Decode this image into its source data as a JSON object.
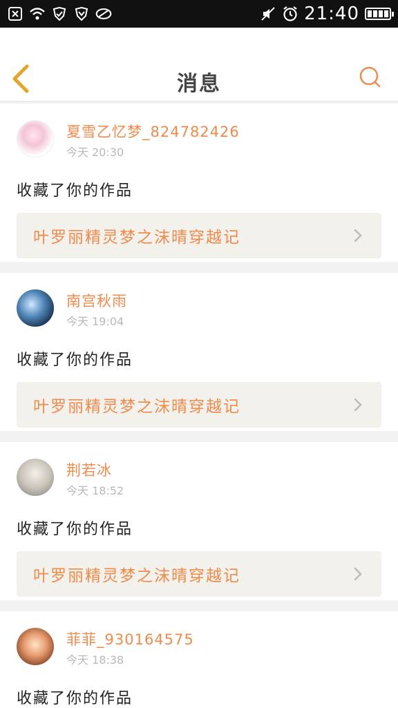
{
  "status_bar": {
    "time": "21:40"
  },
  "nav": {
    "title": "消息"
  },
  "colors": {
    "accent": "#f08a4b",
    "back_chevron": "#e5a52a",
    "link_bg": "#f2f1ec",
    "timestamp": "#b8b8b8"
  },
  "messages": [
    {
      "username": "夏雪乙忆梦_824782426",
      "time": "今天 20:30",
      "action": "收藏了你的作品",
      "work_title": "叶罗丽精灵梦之沫晴穿越记"
    },
    {
      "username": "南宫秋雨",
      "time": "今天 19:04",
      "action": "收藏了你的作品",
      "work_title": "叶罗丽精灵梦之沫晴穿越记"
    },
    {
      "username": "荆若冰",
      "time": "今天 18:52",
      "action": "收藏了你的作品",
      "work_title": "叶罗丽精灵梦之沫晴穿越记"
    },
    {
      "username": "菲菲_930164575",
      "time": "今天 18:38",
      "action": "收藏了你的作品"
    }
  ]
}
